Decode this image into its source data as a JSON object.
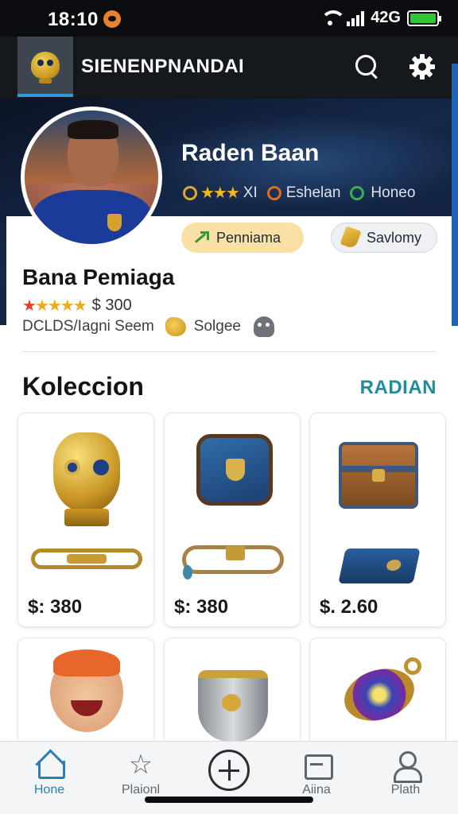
{
  "status_bar": {
    "time": "18:10",
    "battery_text": "42G"
  },
  "header": {
    "app_title": "SIENENPNANDAI",
    "icons": [
      "search-icon",
      "gear-icon"
    ]
  },
  "profile": {
    "display_name": "Raden Baan",
    "meta_x": "XI",
    "meta_label_1": "Eshelan",
    "meta_label_2": "Honeo"
  },
  "actions": {
    "promo_label": "Penniama",
    "saved_label": "Savlomy"
  },
  "details": {
    "name": "Bana Pemiaga",
    "rating_stars": 5,
    "rating_value": "$ 300",
    "stats_text": "DCLDS/Iagni Seem",
    "badge_label": "Solgee"
  },
  "collection": {
    "title": "Koleccion",
    "link_label": "RADIAN",
    "items": [
      {
        "name": "golden-trophy-item",
        "price": "$: 380"
      },
      {
        "name": "blue-bag-item",
        "price": "$: 380"
      },
      {
        "name": "treasure-chest-item",
        "price": "$. 2.60"
      },
      {
        "name": "mascot-item",
        "price": ""
      },
      {
        "name": "silver-cup-item",
        "price": ""
      },
      {
        "name": "amulet-item",
        "price": ""
      }
    ]
  },
  "bottom_nav": {
    "items": [
      {
        "label": "Hone",
        "icon": "home-icon"
      },
      {
        "label": "Plaionl",
        "icon": "star-icon"
      },
      {
        "label": "",
        "icon": "add-icon"
      },
      {
        "label": "Aiina",
        "icon": "wallet-icon"
      },
      {
        "label": "Plath",
        "icon": "profile-icon"
      }
    ]
  },
  "colors": {
    "accent": "#2a7fb3",
    "link": "#1f8c9c",
    "promo_pill": "#fbe0a5",
    "star": "#f2a81c"
  }
}
